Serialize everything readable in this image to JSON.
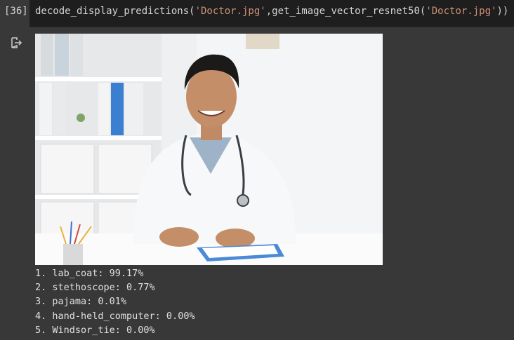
{
  "cell": {
    "exec_count": "[36]",
    "code": {
      "fn1": "decode_display_predictions(",
      "arg1": "'Doctor.jpg'",
      "mid": ",get_image_vector_resnet50(",
      "arg2": "'Doctor.jpg'",
      "end": "))"
    }
  },
  "output": {
    "icon": "output-redirect-icon",
    "image": {
      "subject": "smiling doctor in lab coat with stethoscope at desk"
    },
    "predictions": [
      "1. lab_coat: 99.17%",
      "2. stethoscope: 0.77%",
      "3. pajama: 0.01%",
      "4. hand-held_computer: 0.00%",
      "5. Windsor_tie: 0.00%"
    ]
  },
  "colors": {
    "background": "#383838",
    "code_bg": "#1e1e1e",
    "string": "#ce9178",
    "text": "#d4d4d4"
  }
}
